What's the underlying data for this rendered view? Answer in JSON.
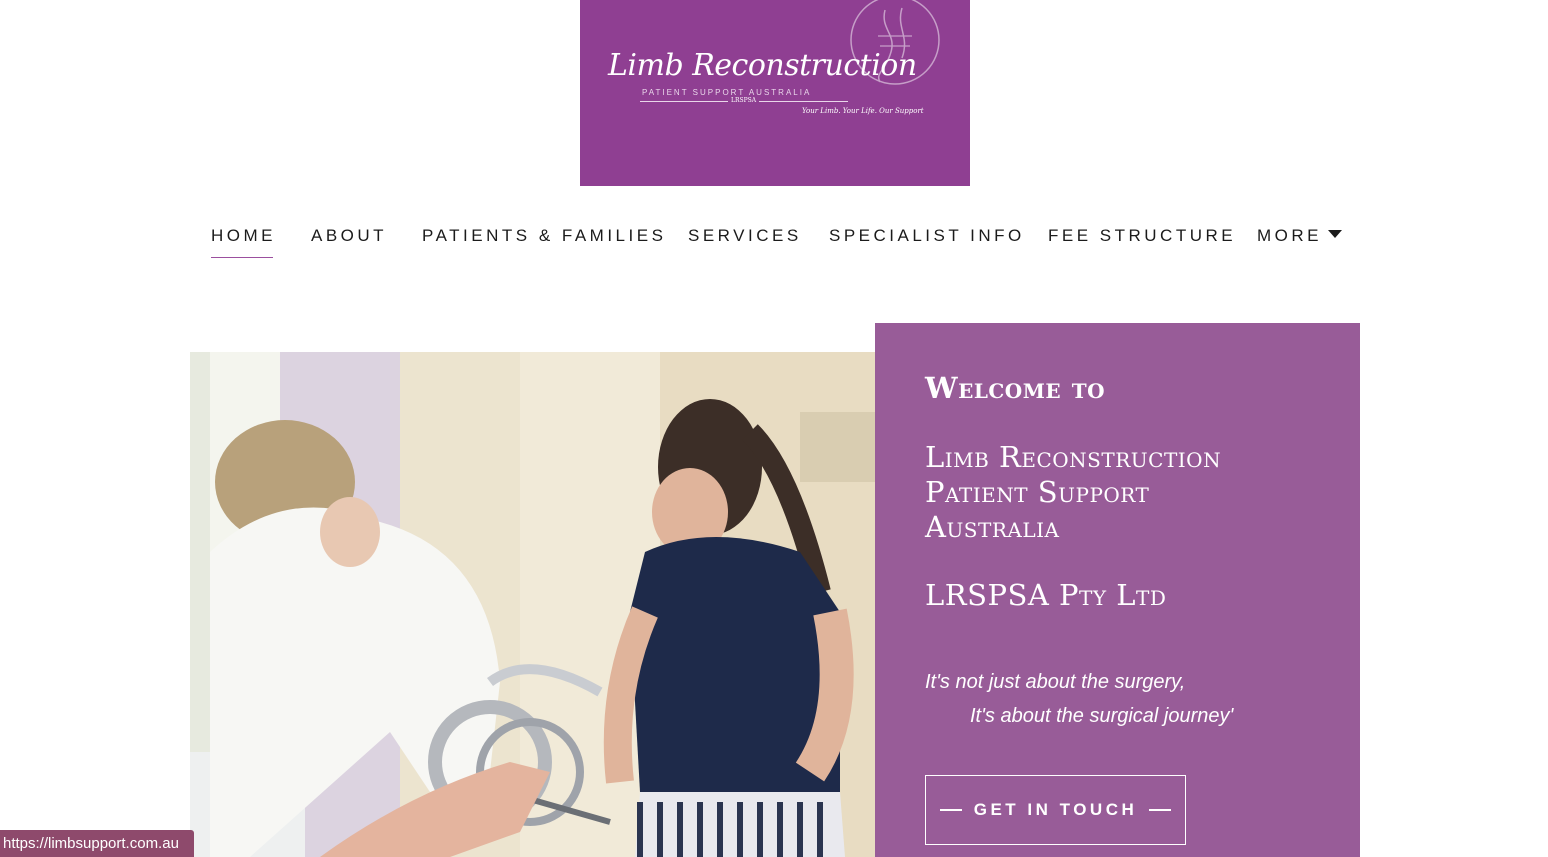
{
  "logo": {
    "title": "Limb Reconstruction",
    "subtitle": "PATIENT SUPPORT AUSTRALIA",
    "abbr": "LRSPSA",
    "tagline": "Your Limb. Your Life. Our Support",
    "bg_color": "#8f3f92"
  },
  "nav": {
    "items": [
      {
        "label": "HOME",
        "active": true
      },
      {
        "label": "ABOUT"
      },
      {
        "label": "PATIENTS & FAMILIES"
      },
      {
        "label": "SERVICES"
      },
      {
        "label": "SPECIALIST INFO"
      },
      {
        "label": "FEE STRUCTURE"
      },
      {
        "label": "MORE"
      }
    ],
    "accent": "#9b4f9e"
  },
  "hero": {
    "welcome": "Welcome to",
    "org_line1": "Limb Reconstruction",
    "org_line2": "Patient Support",
    "org_line3": "Australia",
    "company": "LRSPSA Pty Ltd",
    "quote_line1": "It's not just about the surgery,",
    "quote_line2": "It's about the surgical journey'",
    "cta_label": "GET IN TOUCH",
    "panel_color": "#985c98"
  },
  "status_bar": {
    "url": "https://limbsupport.com.au"
  }
}
